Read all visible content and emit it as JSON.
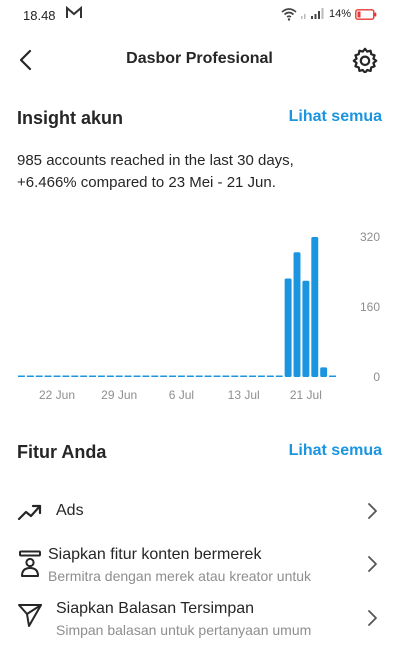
{
  "status": {
    "time": "18.48",
    "battery": "14%",
    "icons": [
      "gmail-icon",
      "wifi-icon",
      "signal-icon",
      "battery-icon"
    ]
  },
  "header": {
    "title": "Dasbor Profesional",
    "back_icon": "back-arrow-icon",
    "settings_icon": "settings-icon"
  },
  "insights": {
    "title": "Insight akun",
    "see_all": "Lihat semua",
    "summary_line1": "985 accounts reached in the last 30 days,",
    "summary_line2": "+6.466% compared to 23 Mei - 21 Jun."
  },
  "chart_data": {
    "type": "bar",
    "x_tick_labels": [
      "22 Jun",
      "29 Jun",
      "6 Jul",
      "13 Jul",
      "21 Jul"
    ],
    "y_ticks": [
      320,
      160,
      0
    ],
    "ylim": [
      0,
      320
    ],
    "values": [
      1,
      1,
      1,
      1,
      1,
      1,
      1,
      1,
      1,
      1,
      1,
      2,
      1,
      1,
      1,
      1,
      1,
      1,
      1,
      1,
      1,
      1,
      1,
      1,
      1,
      1,
      1,
      1,
      1,
      1,
      225,
      285,
      220,
      320,
      22,
      0
    ],
    "bar_color": "#1b95e0",
    "grid": false
  },
  "features": {
    "title": "Fitur Anda",
    "see_all": "Lihat semua",
    "items": [
      {
        "icon": "trending-up-icon",
        "label": "Ads",
        "sub": ""
      },
      {
        "icon": "branded-content-icon",
        "label": "Siapkan fitur konten bermerek",
        "sub": "Bermitra dengan merek atau kreator untuk"
      },
      {
        "icon": "send-icon",
        "label": "Siapkan Balasan Tersimpan",
        "sub": "Simpan balasan untuk pertanyaan umum"
      }
    ]
  },
  "colors": {
    "accent": "#1b95e0",
    "text": "#262626",
    "secondary_text": "#8e8e8e",
    "battery_low": "#e53935"
  }
}
